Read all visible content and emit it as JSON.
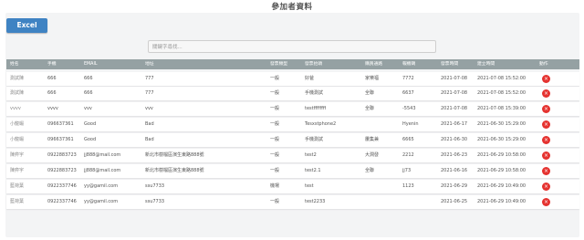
{
  "page": {
    "title": "參加者資料"
  },
  "toolbar": {
    "excel_label": "Excel"
  },
  "search": {
    "placeholder": "關鍵字尋找..."
  },
  "table": {
    "headers": [
      "姓名",
      "手機",
      "EMAIL",
      "地址",
      "發票類型",
      "發票抬頭",
      "購買通路",
      "報機碼",
      "發票時間",
      "建立時間",
      "動作"
    ],
    "rows": [
      [
        "測試陳",
        "666",
        "666",
        "777",
        "一般",
        "好爸",
        "家樂福",
        "7772",
        "2021-07-08",
        "2021-07-08 15:52:00"
      ],
      [
        "測試陳",
        "666",
        "666",
        "777",
        "一般",
        "手機測試",
        "全聯",
        "6637",
        "2021-07-08",
        "2021-07-08 15:52:00"
      ],
      [
        "vvvv",
        "vvvv",
        "vvv",
        "vvv",
        "一般",
        "testffffffff",
        "全聯",
        "-5543",
        "2021-07-08",
        "2021-07-08 15:39:00"
      ],
      [
        "小龍蝦",
        "096637361",
        "Good",
        "Bad",
        "一般",
        "Tesxstphone2",
        "",
        "Hyenin",
        "2021-06-17",
        "2021-06-30 15:29:00"
      ],
      [
        "小龍蝦",
        "096637361",
        "Good",
        "Bad",
        "一般",
        "手機測試",
        "屢集兼",
        "6665",
        "2021-06-30",
        "2021-06-30 15:29:00"
      ],
      [
        "陳弈宇",
        "0922883723",
        "jj888@mail.com",
        "新北市樹檔區演生東路888號",
        "一般",
        "test2",
        "大潤發",
        "2212",
        "2021-06-23",
        "2021-06-29 10:58:00"
      ],
      [
        "陳弈宇",
        "0922883723",
        "jj888@mail.com",
        "新北市樹檔區演生東路888號",
        "一般",
        "test2.1",
        "全聯",
        "jj73",
        "2021-06-16",
        "2021-06-29 10:58:00"
      ],
      [
        "藍荷葉",
        "0922337746",
        "yy@gamil.com",
        "ssu7733",
        "機場",
        "test",
        "",
        "1123",
        "2021-06-29",
        "2021-06-29 10:49:00"
      ],
      [
        "藍荷葉",
        "0922337746",
        "yy@gamil.com",
        "ssu7733",
        "一般",
        "test2233",
        "",
        "",
        "2021-06-25",
        "2021-06-29 10:49:00"
      ]
    ],
    "delete_icon": "close-icon",
    "delete_color": "#e5322f"
  }
}
